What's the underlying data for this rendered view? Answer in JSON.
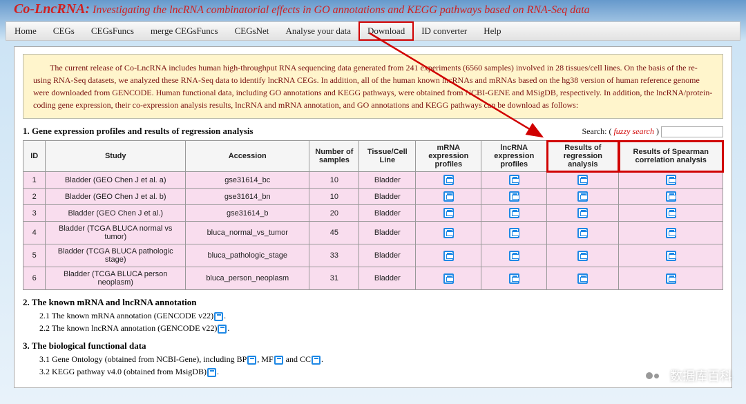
{
  "header": {
    "app_name": "Co-LncRNA:",
    "subtitle": "Investigating the lncRNA combinatorial effects in GO annotations and KEGG pathways based on RNA-Seq data"
  },
  "nav": {
    "items": [
      "Home",
      "CEGs",
      "CEGsFuncs",
      "merge CEGsFuncs",
      "CEGsNet",
      "Analyse your data",
      "Download",
      "ID converter",
      "Help"
    ]
  },
  "info_text": "The current release of Co-LncRNA includes human high-throughput RNA sequencing data generated from 241 experiments (6560 samples) involved in 28 tissues/cell lines. On the basis of the re-using RNA-Seq datasets, we analyzed these RNA-Seq data to identify lncRNA CEGs. In addition, all of the human known lncRNAs and mRNAs based on the hg38 version of human reference genome were downloaded from GENCODE. Human functional data, including GO annotations and KEGG pathways, were obtained from NCBI-GENE and MSigDB, respectively. In addition, the lncRNA/protein-coding gene expression, their co-expression analysis results, lncRNA and mRNA annotation, and GO annotations and KEGG pathways can be download as follows:",
  "section1": {
    "title": "1. Gene expression profiles and results of regression analysis",
    "search_label": "Search: (",
    "fuzzy_label": " fuzzy search ",
    "search_after": ")",
    "headers": {
      "id": "ID",
      "study": "Study",
      "accession": "Accession",
      "num_samples": "Number of samples",
      "tissue": "Tissue/Cell Line",
      "mrna": "mRNA expression profiles",
      "lncrna": "lncRNA expression profiles",
      "regression": "Results of regression analysis",
      "spearman": "Results of Spearman correlation analysis"
    },
    "rows": [
      {
        "id": "1",
        "study": "Bladder (GEO Chen J et al. a)",
        "acc": "gse31614_bc",
        "num": "10",
        "tc": "Bladder"
      },
      {
        "id": "2",
        "study": "Bladder (GEO Chen J et al. b)",
        "acc": "gse31614_bn",
        "num": "10",
        "tc": "Bladder"
      },
      {
        "id": "3",
        "study": "Bladder (GEO Chen J et al.)",
        "acc": "gse31614_b",
        "num": "20",
        "tc": "Bladder"
      },
      {
        "id": "4",
        "study": "Bladder (TCGA BLUCA normal vs tumor)",
        "acc": "bluca_normal_vs_tumor",
        "num": "45",
        "tc": "Bladder"
      },
      {
        "id": "5",
        "study": "Bladder (TCGA BLUCA pathologic stage)",
        "acc": "bluca_pathologic_stage",
        "num": "33",
        "tc": "Bladder"
      },
      {
        "id": "6",
        "study": "Bladder (TCGA BLUCA person neoplasm)",
        "acc": "bluca_person_neoplasm",
        "num": "31",
        "tc": "Bladder"
      }
    ]
  },
  "section2": {
    "title": "2. The known mRNA and lncRNA annotation",
    "item1_a": "2.1 The known mRNA annotation (GENCODE v22)",
    "item1_b": ".",
    "item2_a": "2.2 The known lncRNA annotation (GENCODE v22)",
    "item2_b": "."
  },
  "section3": {
    "title": "3. The biological functional data",
    "item1_a": "3.1 Gene Ontology (obtained from NCBI-Gene), including BP",
    "item1_b": ", MF",
    "item1_c": " and CC",
    "item1_d": ".",
    "item2_a": "3.2 KEGG pathway v4.0 (obtained from MsigDB)",
    "item2_b": "."
  },
  "watermark_text": "数据库百科"
}
